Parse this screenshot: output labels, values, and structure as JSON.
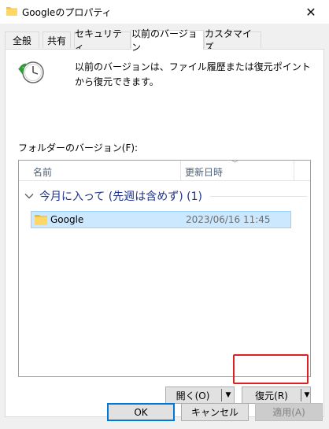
{
  "window": {
    "title": "Googleのプロパティ",
    "close_glyph": "✕"
  },
  "tabs": [
    {
      "label": "全般",
      "active": false
    },
    {
      "label": "共有",
      "active": false
    },
    {
      "label": "セキュリティ",
      "active": false
    },
    {
      "label": "以前のバージョン",
      "active": true
    },
    {
      "label": "カスタマイズ",
      "active": false
    }
  ],
  "previous_versions": {
    "description": "以前のバージョンは、ファイル履歴または復元ポイントから復元できます。",
    "folder_versions_label": "フォルダーのバージョン(F):",
    "columns": {
      "name": "名前",
      "modified": "更新日時"
    },
    "group": {
      "label": "今月に入って (先週は含めず) (1)"
    },
    "rows": [
      {
        "name": "Google",
        "modified": "2023/06/16 11:45",
        "selected": true
      }
    ],
    "open_button": "開く(O)",
    "restore_button": "復元(R)"
  },
  "footer": {
    "ok": "OK",
    "cancel": "キャンセル",
    "apply": "適用(A)"
  },
  "colors": {
    "selection": "#cce8ff",
    "selection_border": "#99d1ff",
    "group_text": "#1e3287",
    "highlight": "#e02020",
    "folder": "#ffd766"
  },
  "icons": {
    "title": "folder-icon",
    "clock": "clock-restore-icon",
    "row": "folder-icon"
  }
}
